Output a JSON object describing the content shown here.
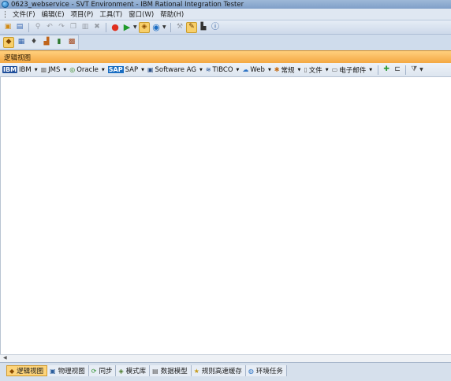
{
  "window": {
    "title": "0623_webservice - SVT Environment - IBM Rational Integration Tester"
  },
  "menu": {
    "items": [
      "文件(F)",
      "编辑(E)",
      "项目(P)",
      "工具(T)",
      "窗口(W)",
      "帮助(H)"
    ]
  },
  "toolbar": {
    "icons": [
      "new-project-icon",
      "save-icon",
      "search-icon",
      "undo-icon",
      "redo-icon",
      "copy-icon",
      "paste-icon",
      "delete-icon",
      "record-icon",
      "run-icon",
      "highlight-icon",
      "sync-icon",
      "tools-icon",
      "settings-icon",
      "lock-icon",
      "help-icon"
    ]
  },
  "perspective": {
    "icons": [
      "logical-view-icon",
      "schema-icon",
      "mic-icon",
      "stats-icon",
      "chart-icon",
      "log-icon"
    ]
  },
  "view_header": {
    "title": "逻辑视图"
  },
  "transports": [
    {
      "label": "IBM",
      "icon": "ibm-icon"
    },
    {
      "label": "JMS",
      "icon": "jms-icon"
    },
    {
      "label": "Oracle",
      "icon": "oracle-icon"
    },
    {
      "label": "SAP",
      "icon": "sap-icon"
    },
    {
      "label": "Software AG",
      "icon": "softwareag-icon"
    },
    {
      "label": "TIBCO",
      "icon": "tibco-icon"
    },
    {
      "label": "Web",
      "icon": "web-icon"
    },
    {
      "label": "常规",
      "icon": "general-icon"
    },
    {
      "label": "文件",
      "icon": "file-icon"
    },
    {
      "label": "电子邮件",
      "icon": "email-icon"
    }
  ],
  "bottom_tabs": [
    {
      "label": "逻辑视图",
      "active": true
    },
    {
      "label": "物理视图",
      "active": false
    },
    {
      "label": "同步",
      "active": false
    },
    {
      "label": "模式库",
      "active": false
    },
    {
      "label": "数据模型",
      "active": false
    },
    {
      "label": "规则高速缓存",
      "active": false
    },
    {
      "label": "环境任务",
      "active": false
    }
  ],
  "colors": {
    "accent_orange": "#f4a843",
    "menu_bg": "#dfe7f2",
    "canvas_bg": "#ffffff"
  }
}
